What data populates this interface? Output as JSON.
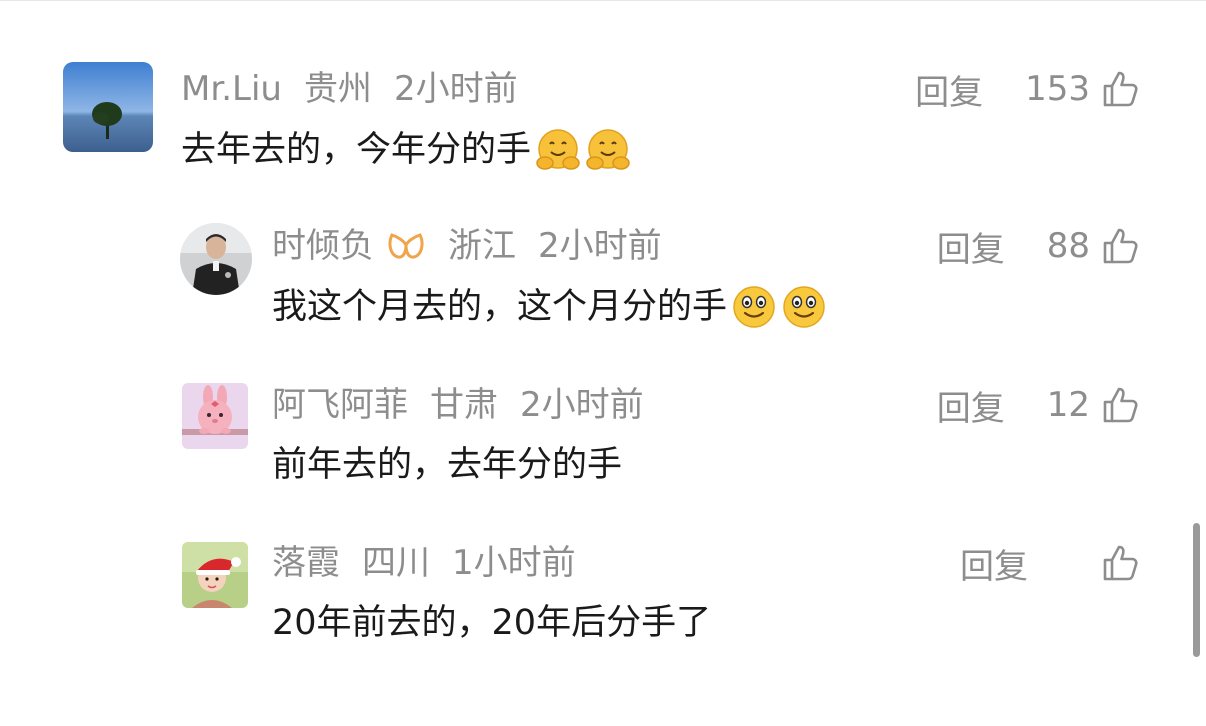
{
  "comments": [
    {
      "user": "Mr.Liu",
      "location": "贵州",
      "time": "2小时前",
      "text": "去年去的，今年分的手",
      "reply_label": "回复",
      "likes": "153",
      "emoji": "hugging-face",
      "avatar": "tree-by-sea-avatar"
    },
    {
      "user": "时倾负",
      "location": "浙江",
      "time": "2小时前",
      "text": "我这个月去的，这个月分的手",
      "reply_label": "回复",
      "likes": "88",
      "emoji": "smiling-face",
      "avatar": "man-in-uniform-avatar",
      "badge": "vip-badge-icon"
    },
    {
      "user": "阿飞阿菲",
      "location": "甘肃",
      "time": "2小时前",
      "text": "前年去的，去年分的手",
      "reply_label": "回复",
      "likes": "12",
      "avatar": "pink-bunny-avatar"
    },
    {
      "user": "落霞",
      "location": "四川",
      "time": "1小时前",
      "text": "20年前去的，20年后分手了",
      "reply_label": "回复",
      "likes": "",
      "avatar": "child-with-santa-hat-avatar"
    }
  ],
  "colors": {
    "meta_text": "#8d8d8d",
    "body_text": "#1a1a1a",
    "badge": "#f0a44b",
    "scrollbar": "#9a9a9a"
  }
}
